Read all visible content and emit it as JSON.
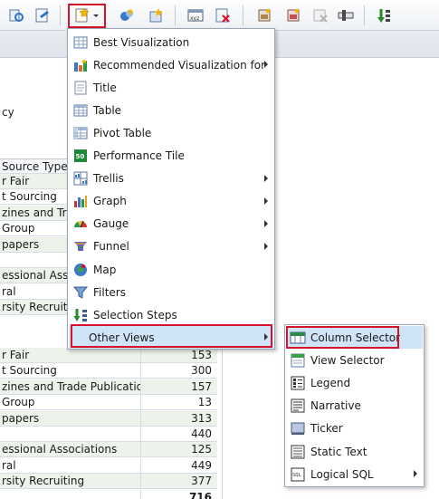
{
  "toolbar": {
    "buttons": [
      {
        "name": "refresh-view-button",
        "icon": "refresh-icon"
      },
      {
        "name": "edit-view-button",
        "icon": "edit-icon"
      },
      {
        "name": "new-view-button",
        "icon": "new-view-icon"
      },
      {
        "name": "add-compound-layout-button",
        "icon": "compound-layout-icon"
      },
      {
        "name": "add-view-button",
        "icon": "add-view-icon"
      },
      {
        "name": "format-container-button",
        "icon": "format-icon"
      },
      {
        "name": "delete-view-button",
        "icon": "delete-icon"
      },
      {
        "name": "view-properties-button",
        "icon": "properties-icon"
      },
      {
        "name": "remove-view-button",
        "icon": "remove-icon"
      },
      {
        "name": "view-settings-button",
        "icon": "settings-icon"
      },
      {
        "name": "sort-button",
        "icon": "sort-icon"
      }
    ]
  },
  "table": {
    "header": "Source Type",
    "top_rows": [
      "r Fair",
      "t Sourcing",
      "zines and Trade",
      "Group",
      "papers",
      "",
      "essional Associa",
      "ral",
      "rsity Recruiting"
    ],
    "partial_row": "cy",
    "bottom_rows": [
      {
        "label": "r Fair",
        "value": "153"
      },
      {
        "label": "t Sourcing",
        "value": "300"
      },
      {
        "label": "zines and Trade Publications",
        "value": "157"
      },
      {
        "label": "Group",
        "value": "13"
      },
      {
        "label": "papers",
        "value": "313"
      },
      {
        "label": "",
        "value": "440"
      },
      {
        "label": "essional Associations",
        "value": "125"
      },
      {
        "label": "ral",
        "value": "449"
      },
      {
        "label": "rsity Recruiting",
        "value": "377"
      }
    ],
    "total": "716"
  },
  "menu": {
    "items": [
      {
        "label": "Best Visualization",
        "icon": "table-grid-icon",
        "submenu": false
      },
      {
        "label": "Recommended Visualization for",
        "icon": "chart-recommend-icon",
        "submenu": true
      },
      {
        "label": "Title",
        "icon": "title-icon",
        "submenu": false
      },
      {
        "label": "Table",
        "icon": "table-icon",
        "submenu": false
      },
      {
        "label": "Pivot Table",
        "icon": "pivot-table-icon",
        "submenu": false
      },
      {
        "label": "Performance Tile",
        "icon": "performance-tile-icon",
        "submenu": false,
        "icon_text": "50"
      },
      {
        "label": "Trellis",
        "icon": "trellis-icon",
        "submenu": true
      },
      {
        "label": "Graph",
        "icon": "graph-icon",
        "submenu": true
      },
      {
        "label": "Gauge",
        "icon": "gauge-icon",
        "submenu": true
      },
      {
        "label": "Funnel",
        "icon": "funnel-icon",
        "submenu": true
      },
      {
        "label": "Map",
        "icon": "map-icon",
        "submenu": false
      },
      {
        "label": "Filters",
        "icon": "filter-icon",
        "submenu": false
      },
      {
        "label": "Selection Steps",
        "icon": "selection-steps-icon",
        "submenu": false
      },
      {
        "label": "Other Views",
        "icon": "",
        "submenu": true,
        "active": true
      }
    ]
  },
  "submenu": {
    "items": [
      {
        "label": "Column Selector",
        "icon": "column-selector-icon",
        "active": true
      },
      {
        "label": "View Selector",
        "icon": "view-selector-icon"
      },
      {
        "label": "Legend",
        "icon": "legend-icon"
      },
      {
        "label": "Narrative",
        "icon": "narrative-icon"
      },
      {
        "label": "Ticker",
        "icon": "ticker-icon"
      },
      {
        "label": "Static Text",
        "icon": "static-text-icon"
      },
      {
        "label": "Logical SQL",
        "icon": "logical-sql-icon",
        "submenu": true
      }
    ]
  },
  "colors": {
    "highlight_border": "#d4122a",
    "active_item_bg": "#cfe4f7",
    "table_shade": "#edf2ea"
  }
}
